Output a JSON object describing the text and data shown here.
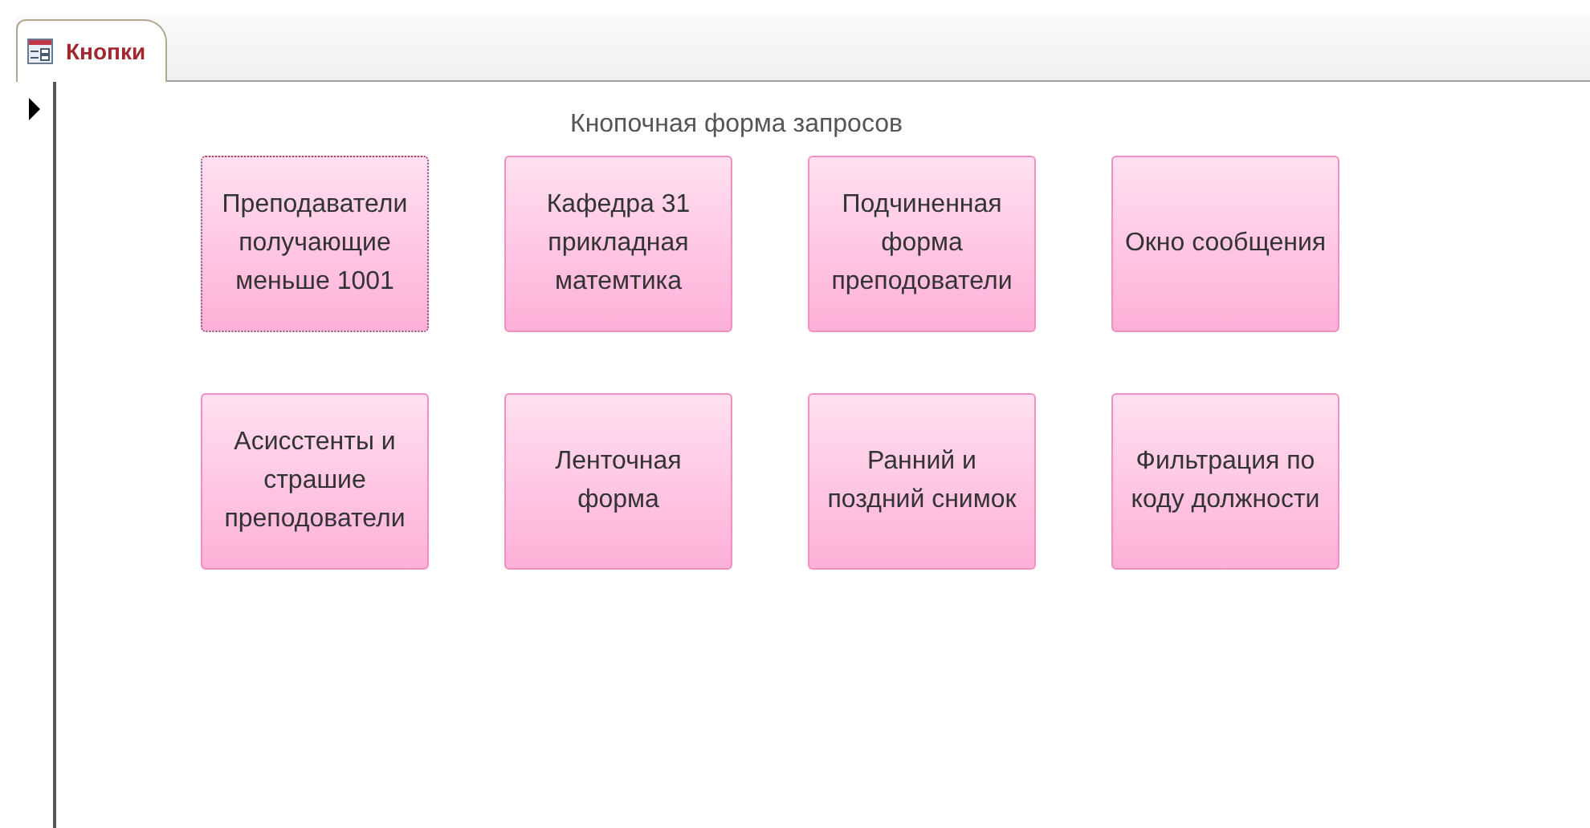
{
  "tabs": [
    {
      "label": "Кнопки",
      "selected": true
    }
  ],
  "record_selector": {
    "current": true
  },
  "form": {
    "title": "Кнопочная форма запросов",
    "buttons": [
      {
        "label": "Преподаватели получающие меньше 1001",
        "focused": true
      },
      {
        "label": "Кафедра 31 прикладная матемтика",
        "focused": false
      },
      {
        "label": "Подчиненная форма преподователи",
        "focused": false
      },
      {
        "label": "Окно сообщения",
        "focused": false
      },
      {
        "label": "Асисстенты и страшие преподователи",
        "focused": false
      },
      {
        "label": "Ленточная форма",
        "focused": false
      },
      {
        "label": "Ранний и поздний снимок",
        "focused": false
      },
      {
        "label": "Фильтрация по коду должности",
        "focused": false
      }
    ]
  }
}
